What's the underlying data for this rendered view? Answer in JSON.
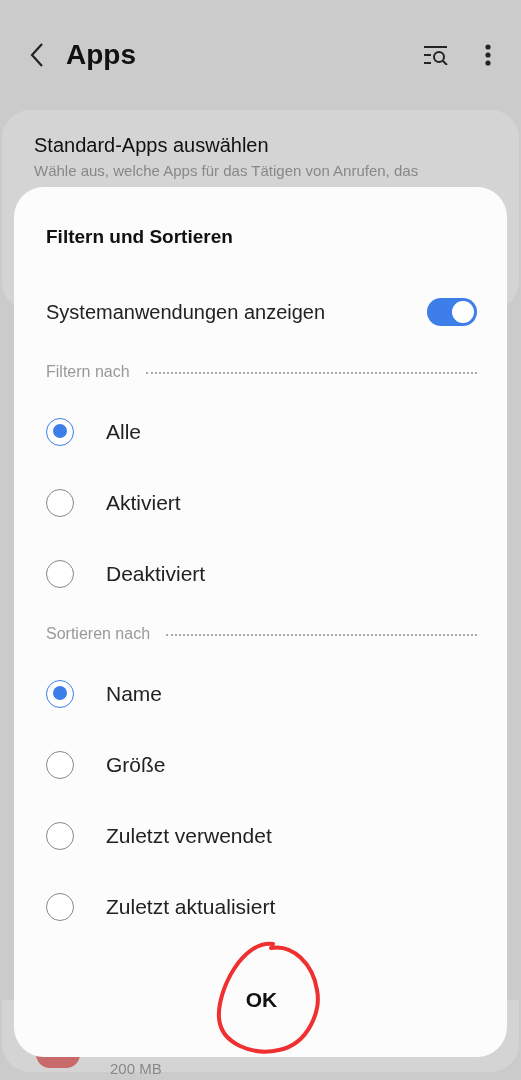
{
  "app_bar": {
    "title": "Apps"
  },
  "background_card": {
    "title": "Standard-Apps auswählen",
    "description": "Wähle aus, welche Apps für das Tätigen von Anrufen, das"
  },
  "background_item": {
    "size": "200 MB"
  },
  "dialog": {
    "title": "Filtern und Sortieren",
    "toggle": {
      "label": "Systemanwendungen anzeigen",
      "on": true
    },
    "sections": [
      {
        "header": "Filtern nach",
        "options": [
          {
            "label": "Alle",
            "selected": true
          },
          {
            "label": "Aktiviert",
            "selected": false
          },
          {
            "label": "Deaktiviert",
            "selected": false
          }
        ]
      },
      {
        "header": "Sortieren nach",
        "options": [
          {
            "label": "Name",
            "selected": true
          },
          {
            "label": "Größe",
            "selected": false
          },
          {
            "label": "Zuletzt verwendet",
            "selected": false
          },
          {
            "label": "Zuletzt aktualisiert",
            "selected": false
          }
        ]
      }
    ],
    "button": "OK"
  }
}
